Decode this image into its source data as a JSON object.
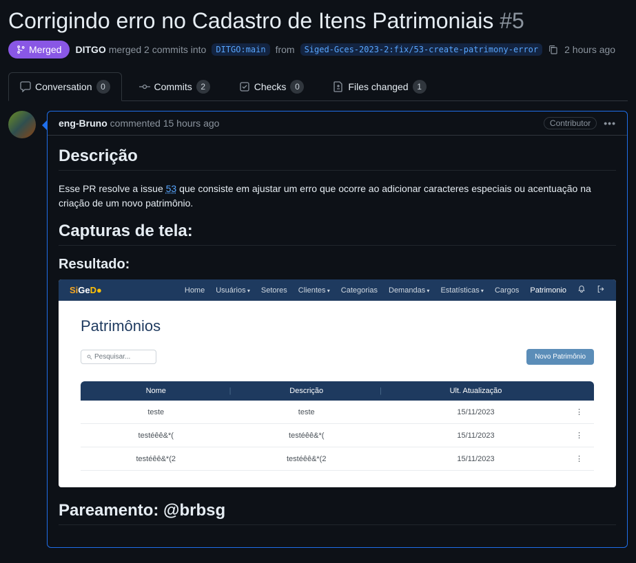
{
  "title": "Corrigindo erro no Cadastro de Itens Patrimoniais",
  "issue_number": "#5",
  "status_badge": "Merged",
  "merge_meta": {
    "actor": "DITGO",
    "action_prefix": "merged 2 commits into",
    "base_branch": "DITGO:main",
    "from_word": "from",
    "head_branch": "Siged-Gces-2023-2:fix/53-create-patrimony-error",
    "time": "2 hours ago"
  },
  "tabs": [
    {
      "label": "Conversation",
      "count": "0"
    },
    {
      "label": "Commits",
      "count": "2"
    },
    {
      "label": "Checks",
      "count": "0"
    },
    {
      "label": "Files changed",
      "count": "1"
    }
  ],
  "comment": {
    "author": "eng-Bruno",
    "verb": "commented",
    "time": "15 hours ago",
    "badge": "Contributor",
    "h_desc": "Descrição",
    "desc_pre": "Esse PR resolve a issue ",
    "issue_link": "53",
    "desc_post": " que consiste em ajustar um erro que ocorre ao adicionar caracteres especiais ou acentuação na criação de um novo patrimônio.",
    "h_captures": "Capturas de tela:",
    "h_result": "Resultado:",
    "h_pairing": "Pareamento: @brbsg"
  },
  "embedded": {
    "logo_si": "Si",
    "logo_ge": "Ge",
    "logo_d": "D",
    "nav": [
      {
        "label": "Home",
        "caret": false
      },
      {
        "label": "Usuários",
        "caret": true
      },
      {
        "label": "Setores",
        "caret": false
      },
      {
        "label": "Clientes",
        "caret": true
      },
      {
        "label": "Categorias",
        "caret": false
      },
      {
        "label": "Demandas",
        "caret": true
      },
      {
        "label": "Estatísticas",
        "caret": true
      },
      {
        "label": "Cargos",
        "caret": false
      },
      {
        "label": "Patrimonio",
        "caret": false,
        "active": true
      }
    ],
    "page_title": "Patrimônios",
    "search_placeholder": "Pesquisar...",
    "new_btn": "Novo Patrimônio",
    "table": {
      "headers": [
        "Nome",
        "Descrição",
        "Ult. Atualização"
      ],
      "rows": [
        {
          "nome": "teste",
          "desc": "teste",
          "date": "15/11/2023"
        },
        {
          "nome": "testéêê&*(",
          "desc": "testéêê&*(",
          "date": "15/11/2023"
        },
        {
          "nome": "testéêê&*(2",
          "desc": "testéêê&*(2",
          "date": "15/11/2023"
        }
      ]
    }
  }
}
